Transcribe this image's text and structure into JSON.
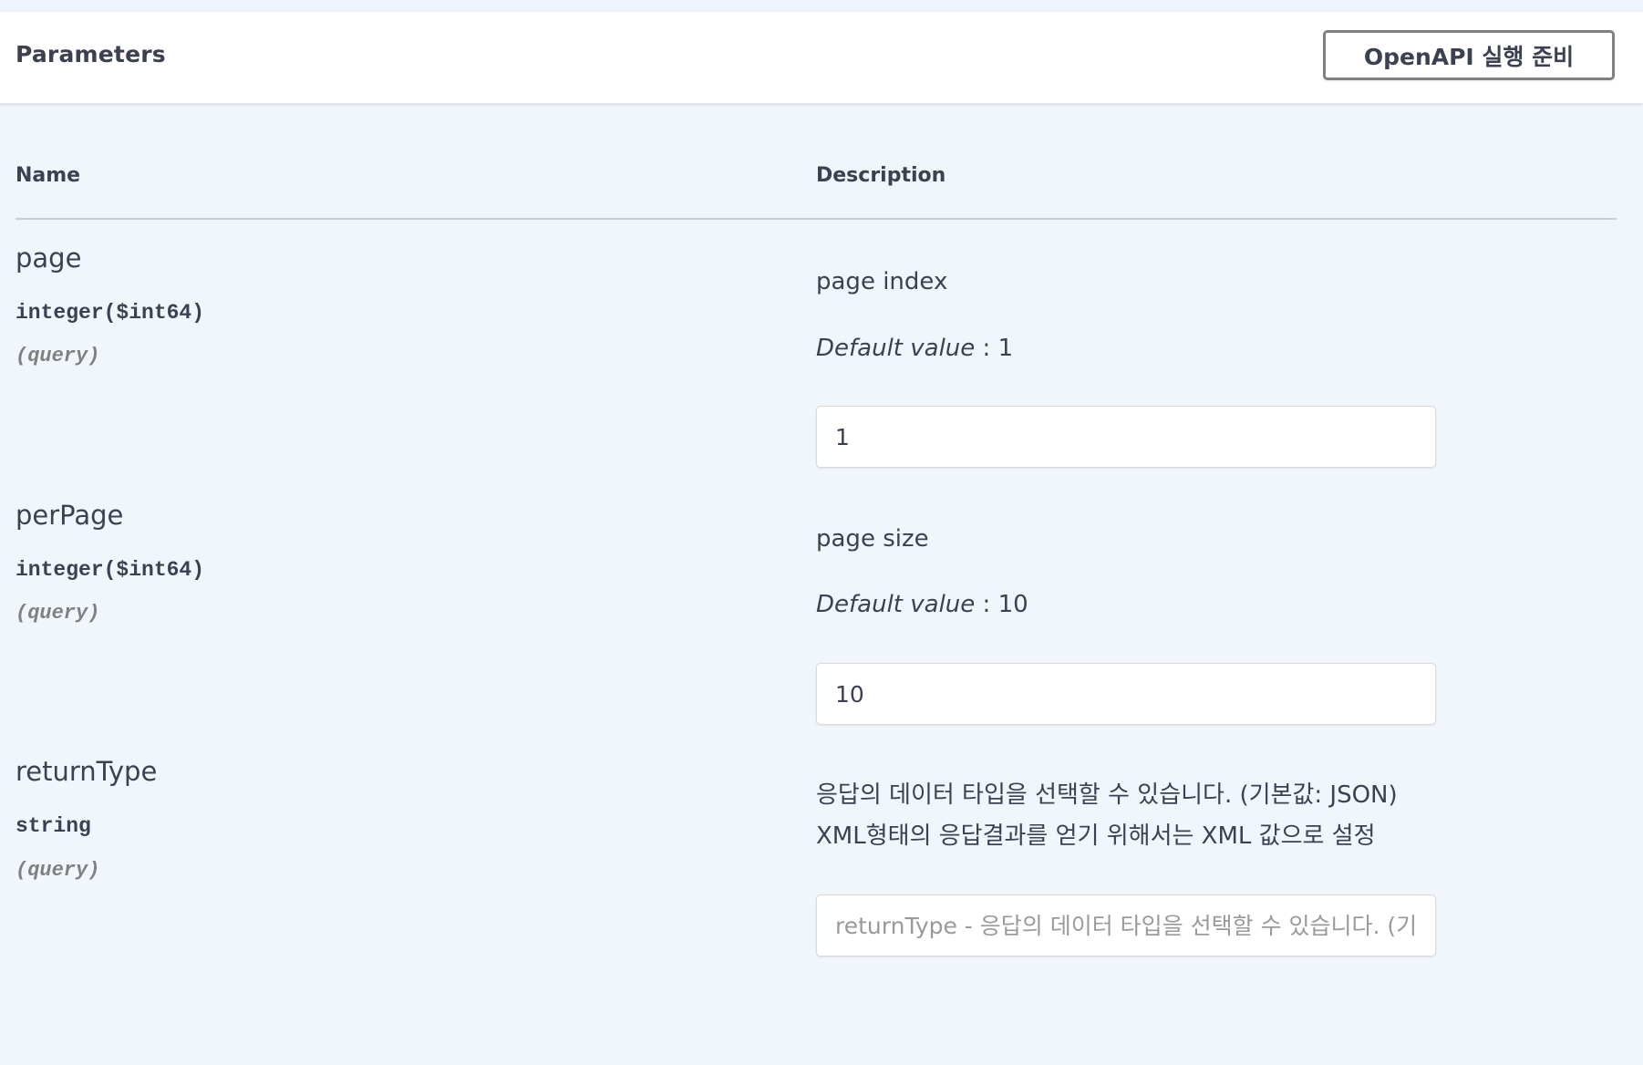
{
  "header": {
    "title": "Parameters",
    "try_button_label": "OpenAPI 실행 준비"
  },
  "columns": {
    "name": "Name",
    "description": "Description"
  },
  "default_label": "Default value",
  "params": [
    {
      "name": "page",
      "type": "integer($int64)",
      "in": "(query)",
      "description": "page index",
      "default": ": 1",
      "value": "1",
      "placeholder": ""
    },
    {
      "name": "perPage",
      "type": "integer($int64)",
      "in": "(query)",
      "description": "page size",
      "default": ": 10",
      "value": "10",
      "placeholder": ""
    },
    {
      "name": "returnType",
      "type": "string",
      "in": "(query)",
      "description_lines": [
        "응답의 데이터 타입을 선택할 수 있습니다. (기본값: JSON)",
        "XML형태의 응답결과를 얻기 위해서는 XML 값으로 설정"
      ],
      "value": "",
      "placeholder": "returnType - 응답의 데이터 타입을 선택할 수 있습니다. (기본값: JSON)"
    }
  ]
}
